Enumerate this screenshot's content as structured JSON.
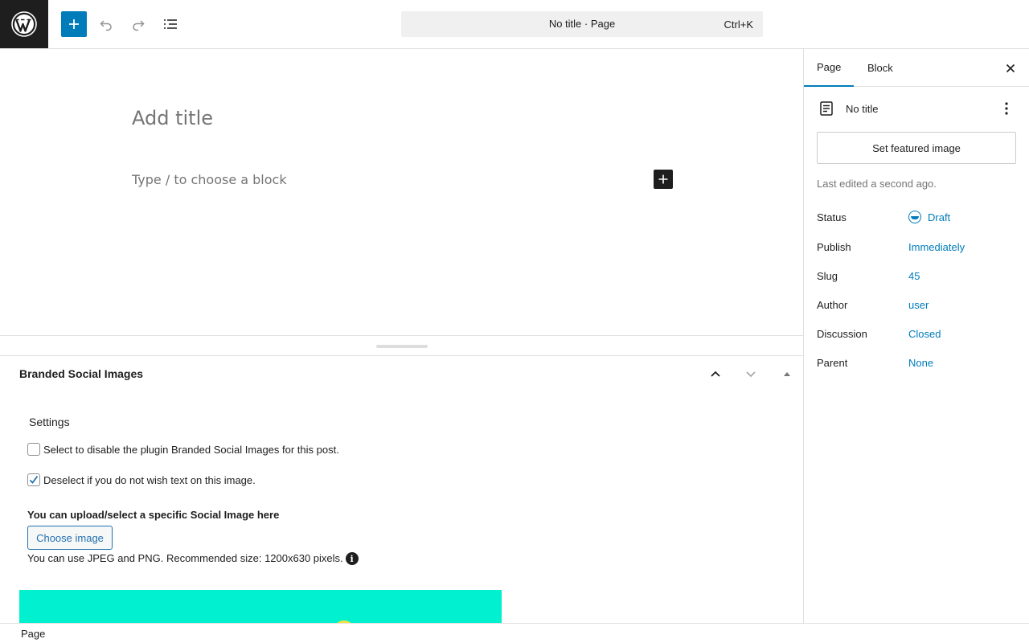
{
  "header": {
    "document_title": "No title · Page",
    "shortcut": "Ctrl+K",
    "icons": [
      "wordpress-logo-icon",
      "plus-icon",
      "undo-icon",
      "redo-icon",
      "document-overview-icon"
    ],
    "accent_color": "#007cba"
  },
  "editor": {
    "title_placeholder": "Add title",
    "block_placeholder": "Type / to choose a block"
  },
  "metabox": {
    "title": "Branded Social Images",
    "settings_heading": "Settings",
    "disable_plugin_label": "Select to disable the plugin Branded Social Images for this post.",
    "disable_plugin_checked": false,
    "text_toggle_label": "Deselect if you do not wish text on this image.",
    "text_toggle_checked": true,
    "upload_label": "You can upload/select a specific Social Image here",
    "choose_button": "Choose image",
    "hint": "You can use JPEG and PNG. Recommended size: 1200x630 pixels.",
    "preview_color": "#00f0d0"
  },
  "sidebar": {
    "tabs": [
      {
        "label": "Page",
        "active": true
      },
      {
        "label": "Block",
        "active": false
      }
    ],
    "doc_title": "No title",
    "featured_button": "Set featured image",
    "last_edited": "Last edited a second ago.",
    "properties": [
      {
        "label": "Status",
        "value": "Draft"
      },
      {
        "label": "Publish",
        "value": "Immediately"
      },
      {
        "label": "Slug",
        "value": "45"
      },
      {
        "label": "Author",
        "value": "user"
      },
      {
        "label": "Discussion",
        "value": "Closed"
      },
      {
        "label": "Parent",
        "value": "None"
      }
    ]
  },
  "footer": {
    "breadcrumb": "Page"
  }
}
